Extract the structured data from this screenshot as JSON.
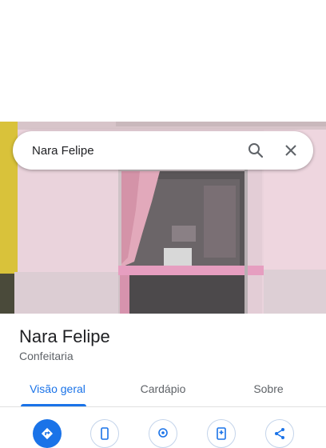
{
  "search": {
    "query": "Nara Felipe"
  },
  "place": {
    "name": "Nara Felipe",
    "category": "Confeitaria"
  },
  "tabs": [
    {
      "label": "Visão geral",
      "active": true
    },
    {
      "label": "Cardápio",
      "active": false
    },
    {
      "label": "Sobre",
      "active": false
    }
  ],
  "actions": [
    {
      "icon": "directions-icon",
      "primary": true
    },
    {
      "icon": "phone-icon",
      "primary": false
    },
    {
      "icon": "location-icon",
      "primary": false
    },
    {
      "icon": "save-icon",
      "primary": false
    },
    {
      "icon": "share-icon",
      "primary": false
    }
  ],
  "colors": {
    "accent": "#1a73e8",
    "storefront_pink": "#f0c8d8",
    "wall_yellow": "#d9c23a"
  }
}
